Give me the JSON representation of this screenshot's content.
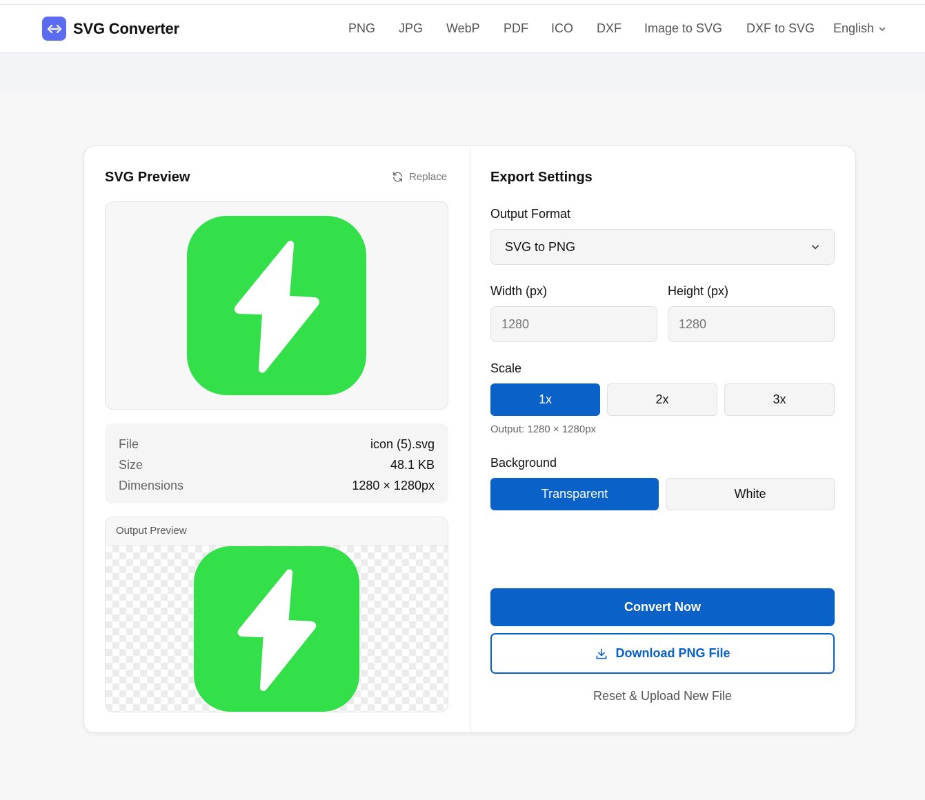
{
  "brand": {
    "name": "SVG Converter",
    "logo_icon": "code-arrows-icon",
    "accent": "#5b6cf0"
  },
  "nav": {
    "items": [
      "PNG",
      "JPG",
      "WebP",
      "PDF",
      "ICO",
      "DXF",
      "Image to SVG",
      "DXF to SVG"
    ],
    "language": "English"
  },
  "preview": {
    "title": "SVG Preview",
    "replace_label": "Replace",
    "icon_color": "#33e04a",
    "info": [
      {
        "label": "File",
        "value": "icon (5).svg"
      },
      {
        "label": "Size",
        "value": "48.1 KB"
      },
      {
        "label": "Dimensions",
        "value": "1280 × 1280px"
      }
    ],
    "output_label": "Output Preview"
  },
  "settings": {
    "title": "Export Settings",
    "format_label": "Output Format",
    "format_value": "SVG to PNG",
    "width_label": "Width (px)",
    "width_value": "1280",
    "height_label": "Height (px)",
    "height_value": "1280",
    "scale_label": "Scale",
    "scale_options": [
      "1x",
      "2x",
      "3x"
    ],
    "scale_selected": "1x",
    "output_hint": "Output: 1280 × 1280px",
    "background_label": "Background",
    "background_options": [
      "Transparent",
      "White"
    ],
    "background_selected": "Transparent",
    "convert_label": "Convert Now",
    "download_label": "Download PNG File",
    "reset_label": "Reset & Upload New File",
    "primary_color": "#0a62c9"
  }
}
